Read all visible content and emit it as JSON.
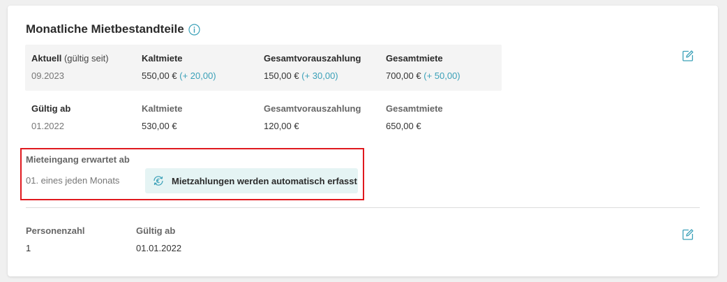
{
  "section": {
    "title": "Monatliche Mietbestandteile"
  },
  "current": {
    "label_bold": "Aktuell",
    "label_suffix": " (gültig seit)",
    "date": "09.2023",
    "kaltmiete_label": "Kaltmiete",
    "kaltmiete_value": "550,00 €",
    "kaltmiete_delta": "(+ 20,00)",
    "vorauszahlung_label": "Gesamtvorauszahlung",
    "vorauszahlung_value": "150,00 €",
    "vorauszahlung_delta": "(+ 30,00)",
    "gesamtmiete_label": "Gesamtmiete",
    "gesamtmiete_value": "700,00 €",
    "gesamtmiete_delta": "(+ 50,00)"
  },
  "previous": {
    "label": "Gültig ab",
    "date": "01.2022",
    "kaltmiete_label": "Kaltmiete",
    "kaltmiete_value": "530,00 €",
    "vorauszahlung_label": "Gesamtvorauszahlung",
    "vorauszahlung_value": "120,00 €",
    "gesamtmiete_label": "Gesamtmiete",
    "gesamtmiete_value": "650,00 €"
  },
  "rent_income": {
    "label": "Mieteingang erwartet ab",
    "value": "01. eines jeden Monats",
    "auto_badge": "Mietzahlungen werden automatisch erfasst"
  },
  "persons": {
    "count_label": "Personenzahl",
    "count_value": "1",
    "valid_label": "Gültig ab",
    "valid_value": "01.01.2022"
  },
  "colors": {
    "accent": "#3aa0b8",
    "highlight_border": "#e0191e",
    "badge_bg": "#e5f4f4"
  },
  "icons": {
    "info": "info-icon",
    "edit": "edit-icon",
    "euro_cycle": "euro-cycle-icon"
  }
}
